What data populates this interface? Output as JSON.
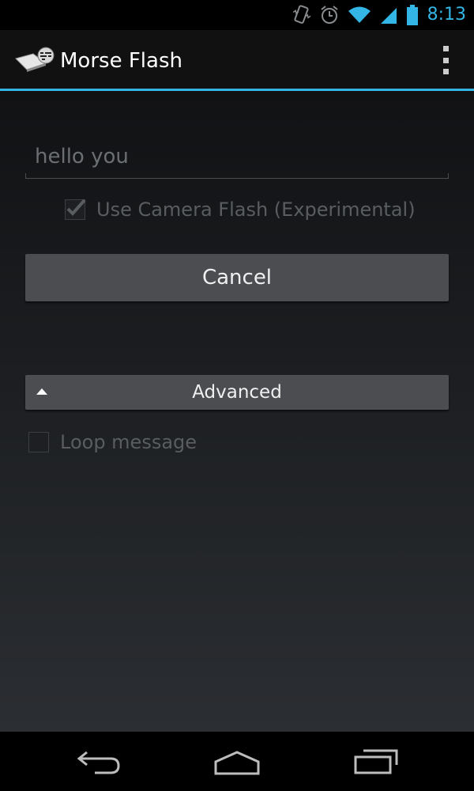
{
  "status_bar": {
    "time": "8:13",
    "icons": [
      "vibrate-icon",
      "alarm-icon",
      "wifi-icon",
      "signal-icon",
      "battery-icon"
    ],
    "accent_color": "#33b5e5"
  },
  "action_bar": {
    "app_icon": "morse-flash-app-icon",
    "title": "Morse Flash",
    "overflow_icon": "overflow-menu-icon"
  },
  "form": {
    "message_value": "hello you",
    "flash_checkbox": {
      "label": "Use Camera Flash (Experimental)",
      "checked": true,
      "enabled": false
    },
    "cancel_label": "Cancel",
    "advanced": {
      "label": "Advanced",
      "icon": "collapse-triangle-icon"
    },
    "loop_checkbox": {
      "label": "Loop message",
      "checked": false,
      "enabled": false
    }
  },
  "nav_bar": {
    "buttons": [
      "back-icon",
      "home-icon",
      "recent-apps-icon"
    ]
  }
}
